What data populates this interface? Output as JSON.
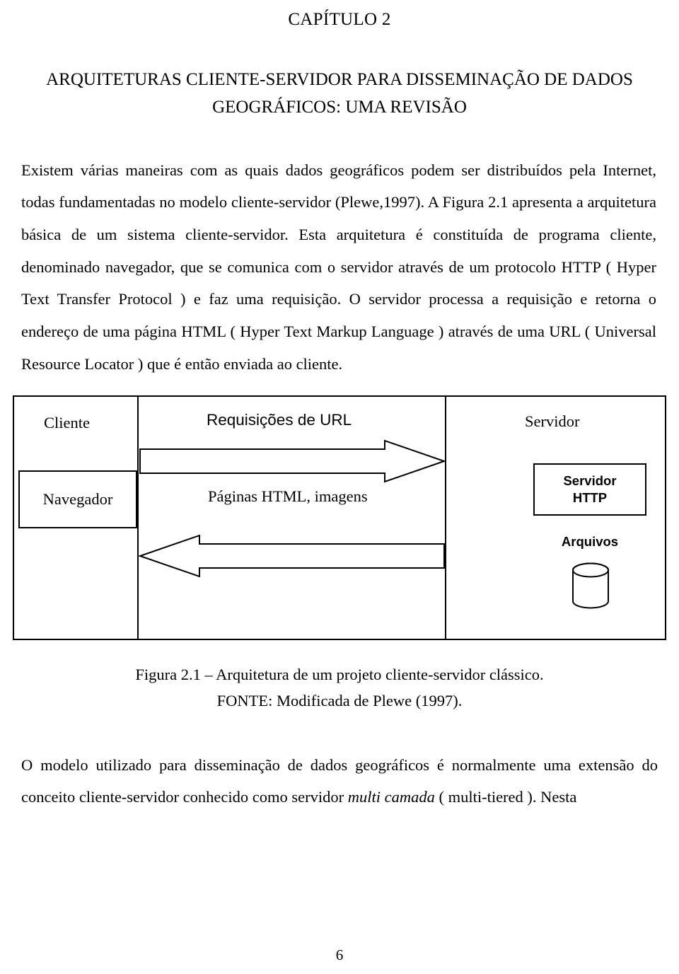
{
  "document": {
    "chapter_label": "CAPÍTULO 2",
    "chapter_title_line1": "ARQUITETURAS CLIENTE-SERVIDOR PARA DISSEMINAÇÃO DE DADOS",
    "chapter_title_line2": "GEOGRÁFICOS: UMA REVISÃO",
    "body_paragraph": "Existem várias maneiras com as quais dados geográficos podem ser distribuídos pela Internet, todas fundamentadas no modelo cliente-servidor (Plewe,1997). A Figura 2.1 apresenta a arquitetura básica de um sistema cliente-servidor. Esta arquitetura é constituída de programa cliente, denominado navegador, que se comunica com o servidor através de um protocolo HTTP ( Hyper Text Transfer Protocol ) e faz uma requisição. O servidor processa a requisição  e retorna o endereço de uma página HTML ( Hyper Text Markup Language ) através de uma URL ( Universal Resource Locator ) que é então enviada ao cliente.",
    "figure": {
      "client_label": "Cliente",
      "browser_label": "Navegador",
      "server_label": "Servidor",
      "server_http_line1": "Servidor",
      "server_http_line2": "HTTP",
      "files_label": "Arquivos",
      "request_label": "Requisições de URL",
      "response_label": "Páginas HTML, imagens"
    },
    "figure_caption_line1": "Figura 2.1 – Arquitetura de um projeto cliente-servidor clássico.",
    "figure_caption_line2": "FONTE: Modificada de Plewe (1997).",
    "tail_paragraph_part1": "O modelo utilizado para disseminação de dados geográficos é normalmente uma extensão do conceito cliente-servidor conhecido como servidor ",
    "tail_paragraph_italic": "multi camada",
    "tail_paragraph_part2": " ( multi-tiered ). Nesta",
    "page_number": "6"
  }
}
